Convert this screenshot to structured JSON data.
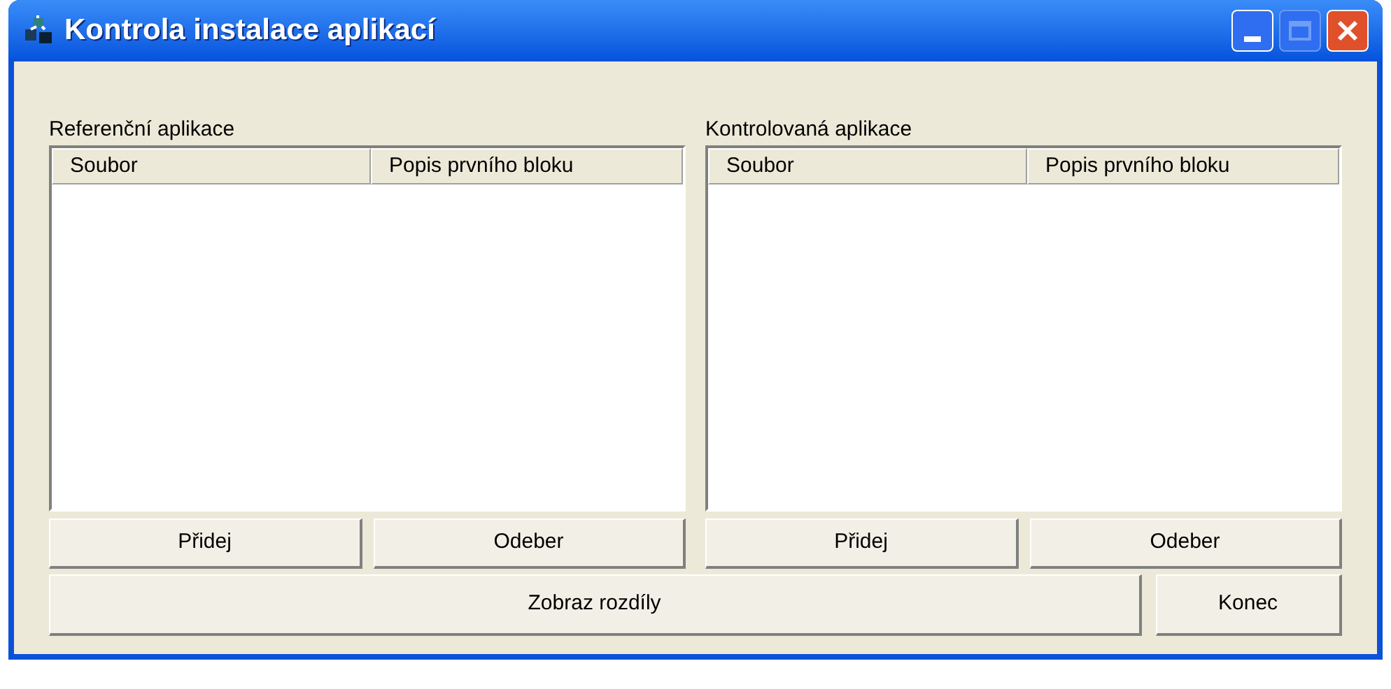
{
  "window": {
    "title": "Kontrola instalace aplikací"
  },
  "panels": [
    {
      "label": "Referenční aplikace",
      "columns": [
        "Soubor",
        "Popis prvního bloku"
      ],
      "buttons": [
        "Přidej",
        "Odeber"
      ]
    },
    {
      "label": "Kontrolovaná aplikace",
      "columns": [
        "Soubor",
        "Popis prvního bloku"
      ],
      "buttons": [
        "Přidej",
        "Odeber"
      ]
    }
  ],
  "bottom_buttons": [
    "Zobraz rozdíly",
    "Konec"
  ]
}
